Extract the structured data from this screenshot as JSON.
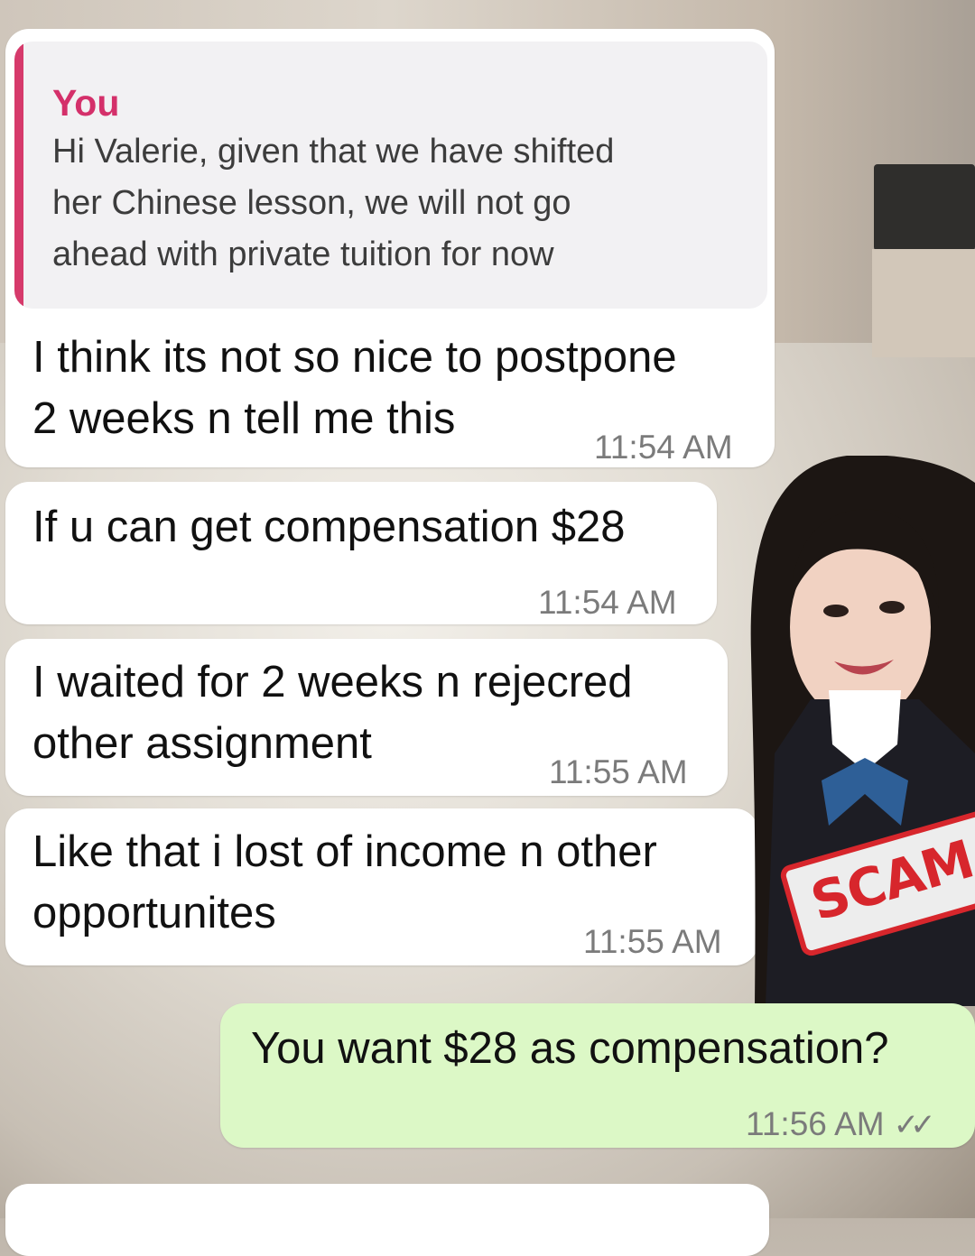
{
  "colors": {
    "incoming_bubble": "#ffffff",
    "outgoing_bubble": "#dcf8c6",
    "reply_accent": "#d4306a",
    "stamp_red": "#d7262c"
  },
  "reply": {
    "author": "You",
    "lines": [
      "Hi Valerie, given that we have shifted",
      "her Chinese lesson, we will not go",
      "ahead with private tuition for now"
    ]
  },
  "messages": [
    {
      "lines": [
        "I think its not so nice to postpone",
        "2 weeks n tell me this"
      ],
      "time": "11:54 AM"
    },
    {
      "lines": [
        "If u can get compensation $28"
      ],
      "time": "11:54 AM"
    },
    {
      "lines": [
        "I waited for 2 weeks n rejecred",
        "other assignment"
      ],
      "time": "11:55 AM"
    },
    {
      "lines": [
        "Like that i lost of income n other",
        "opportunites"
      ],
      "time": "11:55 AM"
    },
    {
      "lines": [
        "You want $28 as compensation?"
      ],
      "time": "11:56 AM",
      "status_icon": "double-check-icon"
    }
  ],
  "stamp": {
    "text": "SCAM AL"
  }
}
